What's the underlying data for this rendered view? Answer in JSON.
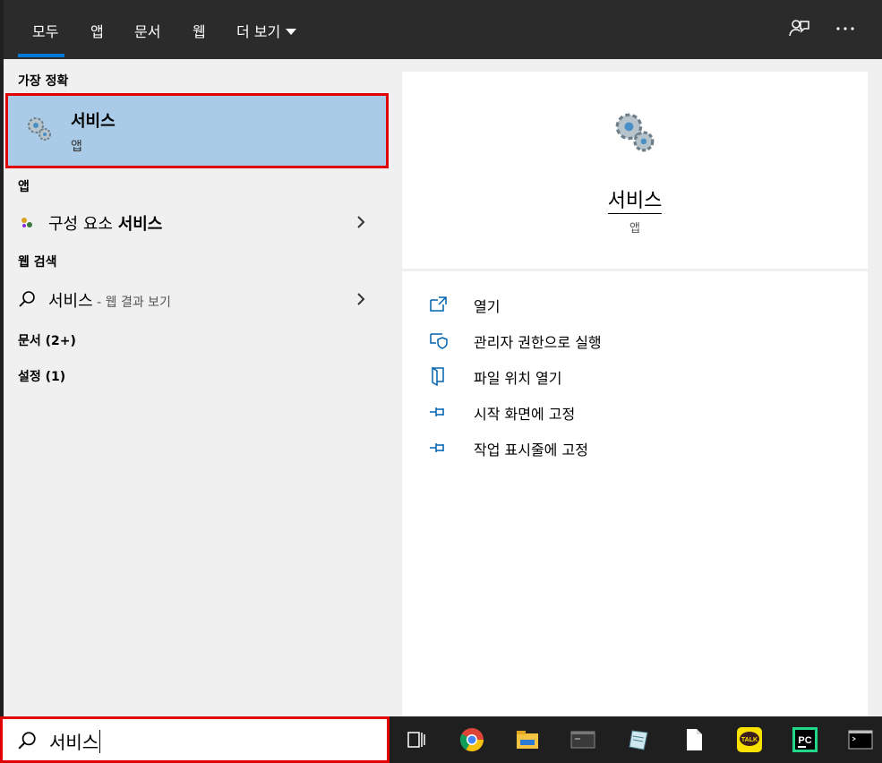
{
  "tabs": [
    {
      "label": "모두"
    },
    {
      "label": "앱"
    },
    {
      "label": "문서"
    },
    {
      "label": "웹"
    },
    {
      "label": "더 보기"
    }
  ],
  "left": {
    "best_match_header": "가장 정확",
    "best_match": {
      "title": "서비스",
      "subtitle": "앱",
      "icon": "services-gear-icon"
    },
    "apps_header": "앱",
    "app_result": {
      "text_plain": "구성 요소 ",
      "text_bold": "서비스"
    },
    "web_header": "웹 검색",
    "web_result": {
      "text": "서비스",
      "suffix": " - 웹 결과 보기"
    },
    "documents_header": "문서 (2+)",
    "settings_header": "설정 (1)"
  },
  "right": {
    "title": "서비스",
    "subtitle": "앱",
    "actions": [
      {
        "label": "열기",
        "icon": "open-icon"
      },
      {
        "label": "관리자 권한으로 실행",
        "icon": "shield-icon"
      },
      {
        "label": "파일 위치 열기",
        "icon": "file-location-icon"
      },
      {
        "label": "시작 화면에 고정",
        "icon": "pin-icon"
      },
      {
        "label": "작업 표시줄에 고정",
        "icon": "pin-icon"
      }
    ]
  },
  "search": {
    "value": "서비스"
  },
  "colors": {
    "accent": "#0078d7",
    "highlight": "#a9cbe8",
    "outline": "#e00000"
  }
}
